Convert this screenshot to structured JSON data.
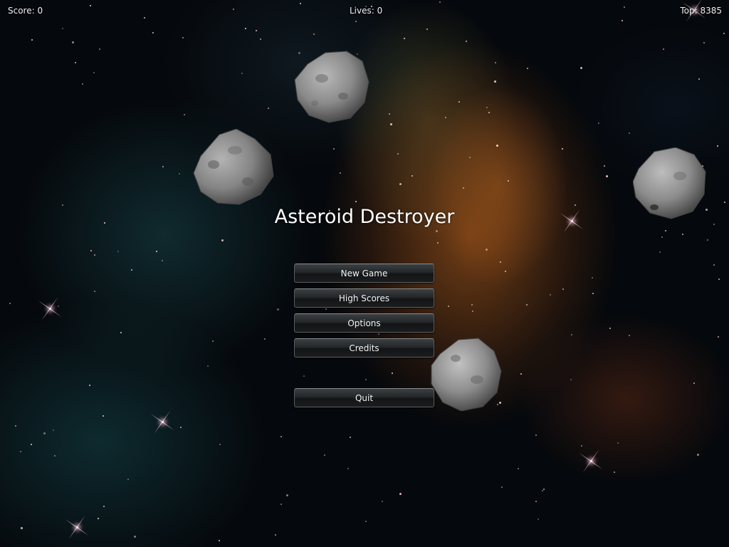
{
  "hud": {
    "score": "Score: 0",
    "lives": "Lives: 0",
    "top": "Top: 8385"
  },
  "title": "Asteroid Destroyer",
  "menu": {
    "new_game": "New Game",
    "high_scores": "High Scores",
    "options": "Options",
    "credits": "Credits",
    "quit": "Quit"
  },
  "asteroids": [
    "asteroid-1",
    "asteroid-2",
    "asteroid-3",
    "asteroid-4"
  ],
  "colors": {
    "nebula_orange": "#9a5020",
    "nebula_teal": "#1a4a4e",
    "space": "#05080c",
    "button_dark": "#1a1c1e",
    "text": "#f2f2f2"
  }
}
